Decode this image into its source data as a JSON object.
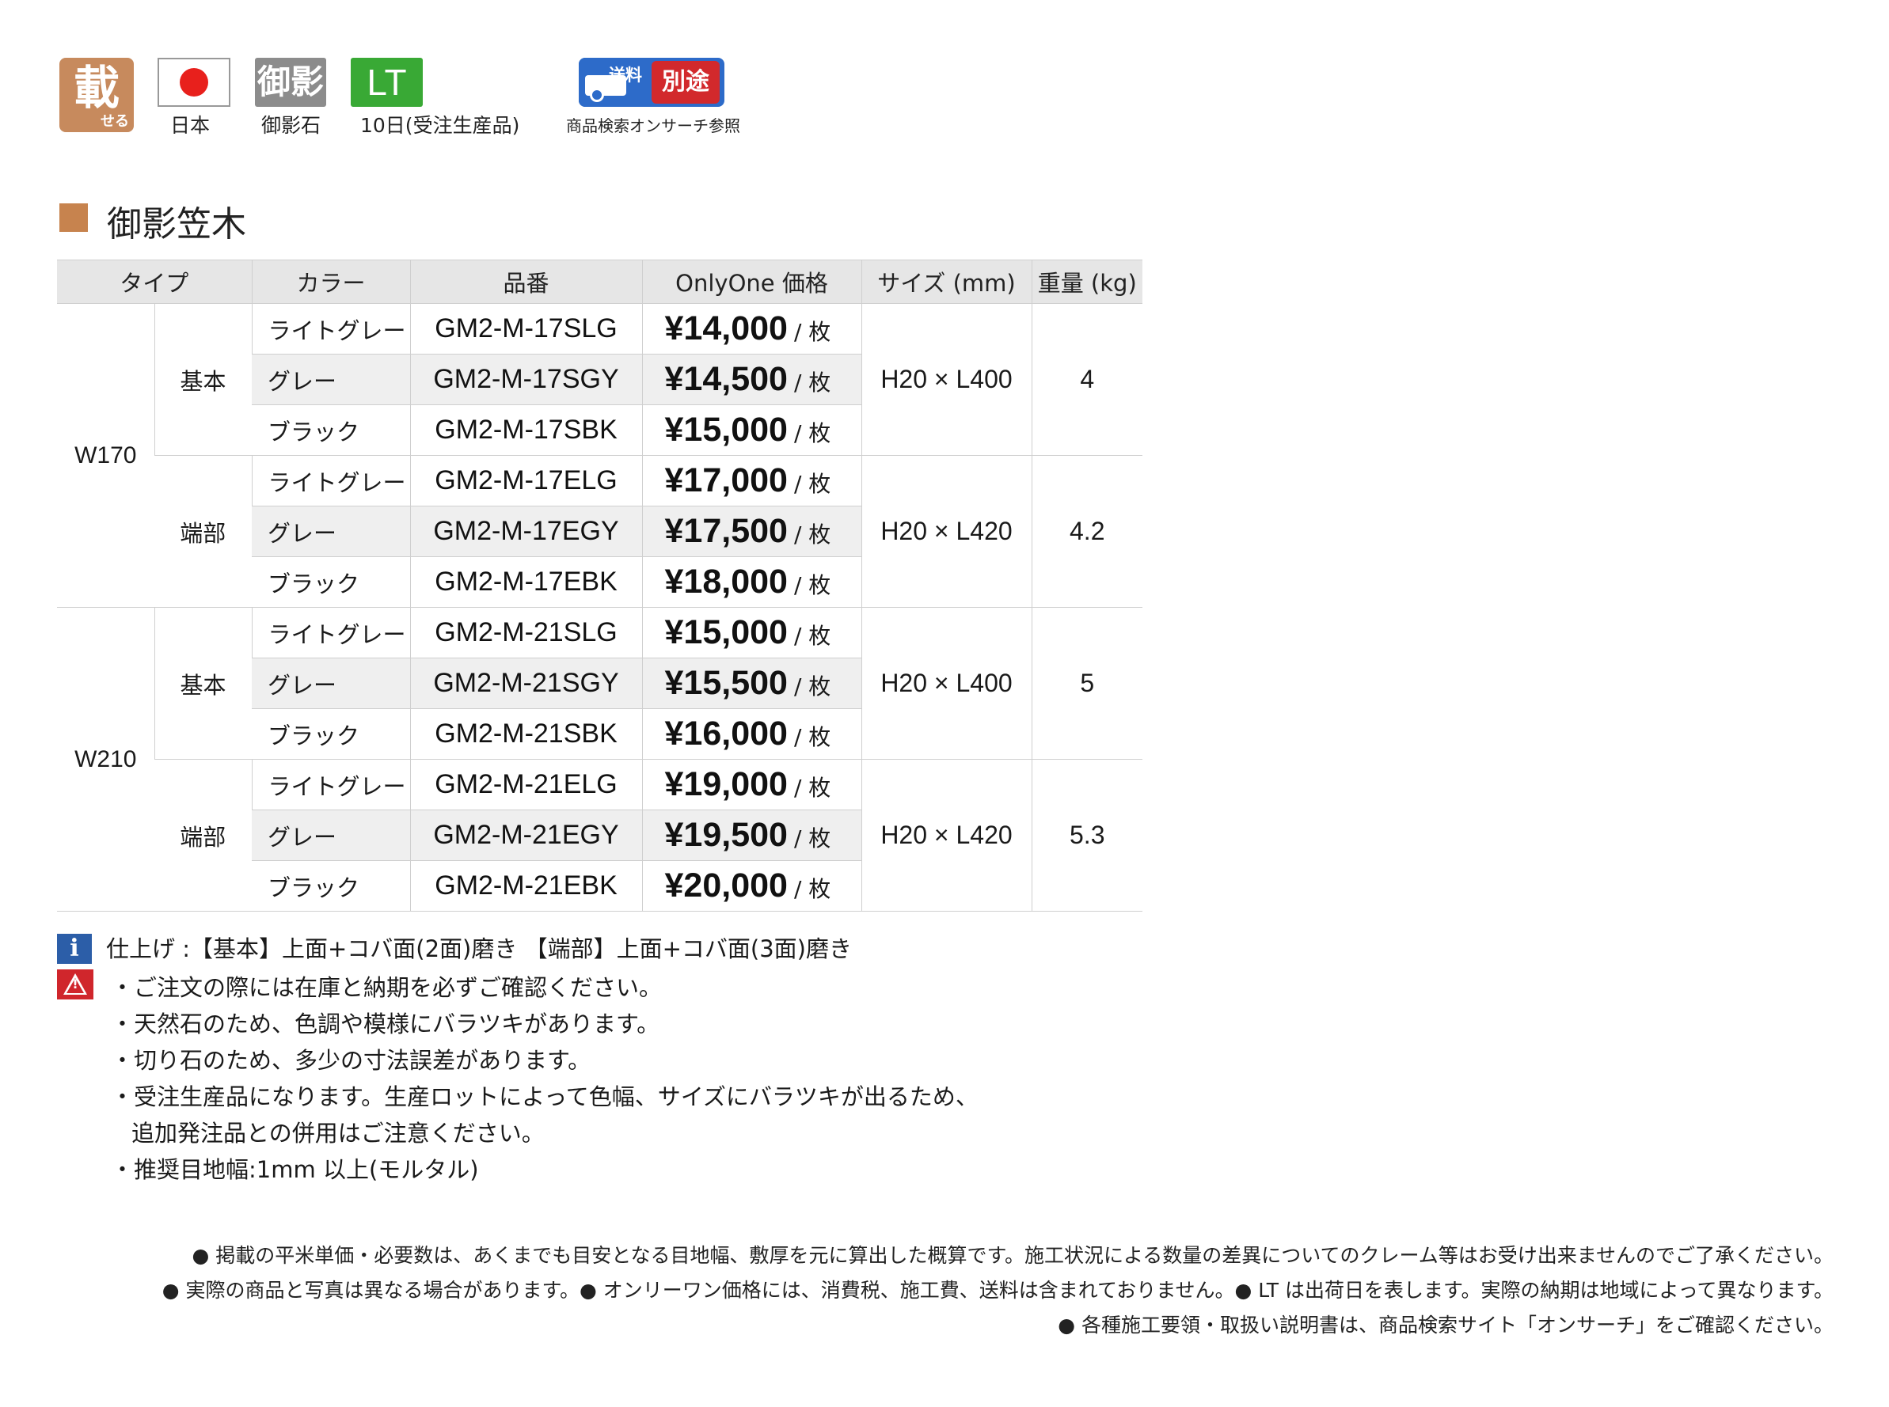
{
  "icons": [
    {
      "name": "noseru-icon",
      "main": "載",
      "sub": "せる",
      "label": ""
    },
    {
      "name": "japan-flag-icon",
      "label": "日本"
    },
    {
      "name": "granite-icon",
      "glyph": "御影",
      "label": "御影石"
    },
    {
      "name": "lt-icon",
      "glyph": "LT",
      "label": "10日(受注生産品)"
    },
    {
      "name": "shipping-icon",
      "left": "送料",
      "right": "別途",
      "label": "商品検索オンサーチ参照"
    }
  ],
  "section_title": "御影笠木",
  "table": {
    "headers": [
      "タイプ",
      "カラー",
      "品番",
      "OnlyOne 価格",
      "サイズ (mm)",
      "重量 (kg)"
    ],
    "price_unit": "/ 枚",
    "groups": [
      {
        "width": "W170",
        "types": [
          {
            "type": "基本",
            "size": "H20 × L400",
            "weight": "4",
            "rows": [
              {
                "color": "ライトグレー",
                "code": "GM2-M-17SLG",
                "price": "¥14,000"
              },
              {
                "color": "グレー",
                "code": "GM2-M-17SGY",
                "price": "¥14,500"
              },
              {
                "color": "ブラック",
                "code": "GM2-M-17SBK",
                "price": "¥15,000"
              }
            ]
          },
          {
            "type": "端部",
            "size": "H20 × L420",
            "weight": "4.2",
            "rows": [
              {
                "color": "ライトグレー",
                "code": "GM2-M-17ELG",
                "price": "¥17,000"
              },
              {
                "color": "グレー",
                "code": "GM2-M-17EGY",
                "price": "¥17,500"
              },
              {
                "color": "ブラック",
                "code": "GM2-M-17EBK",
                "price": "¥18,000"
              }
            ]
          }
        ]
      },
      {
        "width": "W210",
        "types": [
          {
            "type": "基本",
            "size": "H20 × L400",
            "weight": "5",
            "rows": [
              {
                "color": "ライトグレー",
                "code": "GM2-M-21SLG",
                "price": "¥15,000"
              },
              {
                "color": "グレー",
                "code": "GM2-M-21SGY",
                "price": "¥15,500"
              },
              {
                "color": "ブラック",
                "code": "GM2-M-21SBK",
                "price": "¥16,000"
              }
            ]
          },
          {
            "type": "端部",
            "size": "H20 × L420",
            "weight": "5.3",
            "rows": [
              {
                "color": "ライトグレー",
                "code": "GM2-M-21ELG",
                "price": "¥19,000"
              },
              {
                "color": "グレー",
                "code": "GM2-M-21EGY",
                "price": "¥19,500"
              },
              {
                "color": "ブラック",
                "code": "GM2-M-21EBK",
                "price": "¥20,000"
              }
            ]
          }
        ]
      }
    ]
  },
  "info_note": "仕上げ :【基本】上面+コバ面(2面)磨き 【端部】上面+コバ面(3面)磨き",
  "warnings": [
    "・ご注文の際には在庫と納期を必ずご確認ください。",
    "・天然石のため、色調や模様にバラツキがあります。",
    "・切り石のため、多少の寸法誤差があります。",
    "・受注生産品になります。生産ロットによって色幅、サイズにバラツキが出るため、",
    "追加発注品との併用はご注意ください。",
    "・推奨目地幅:1mm 以上(モルタル)"
  ],
  "footnotes": [
    "● 掲載の平米単価・必要数は、あくまでも目安となる目地幅、敷厚を元に算出した概算です。施工状況による数量の差異についてのクレーム等はお受け出来ませんのでご了承ください。",
    "● 実際の商品と写真は異なる場合があります。● オンリーワン価格には、消費税、施工費、送料は含まれておりません。● LT は出荷日を表します。実際の納期は地域によって異なります。",
    "● 各種施工要領・取扱い説明書は、商品検索サイト「オンサーチ」をご確認ください。"
  ],
  "colors": {
    "accent": "#c7834e",
    "info": "#2c5ea8",
    "warning": "#d0262c",
    "lt": "#39a935",
    "header_bg": "#e6e6e6"
  }
}
